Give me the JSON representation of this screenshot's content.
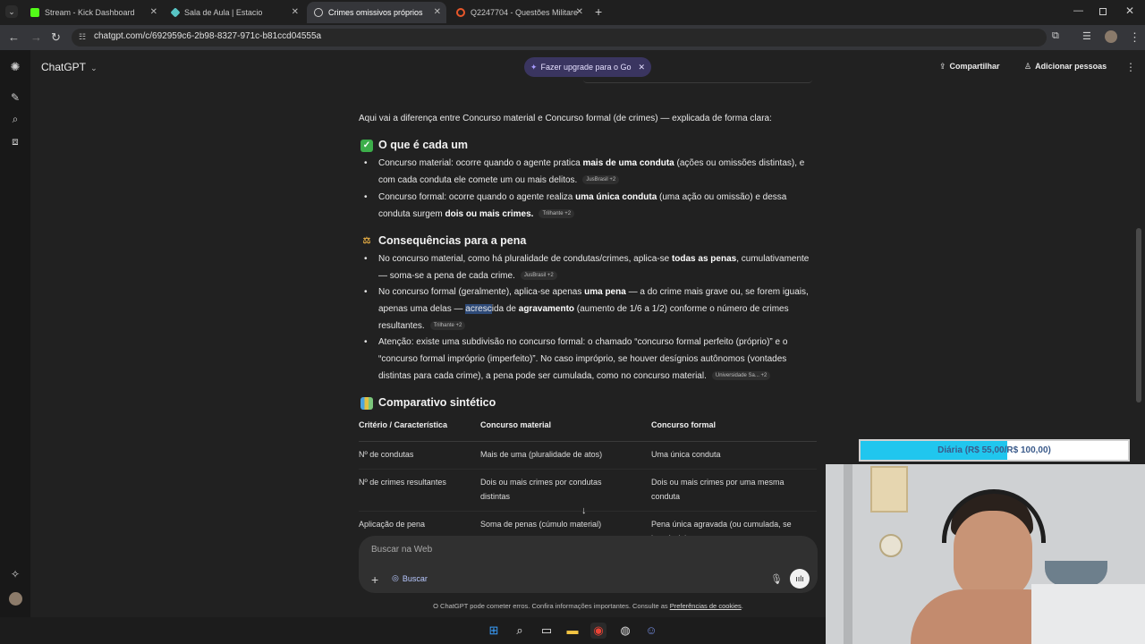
{
  "browser": {
    "tabs": [
      {
        "title": "Stream - Kick Dashboard",
        "color": "#53fc18"
      },
      {
        "title": "Sala de Aula | Estacio",
        "color": "#58c4c4"
      },
      {
        "title": "Crimes omissivos próprios",
        "color": "#cfcfcf"
      },
      {
        "title": "Q2247704 - Questões Militares",
        "color": "#e8572a"
      }
    ],
    "url": "chatgpt.com/c/692959c6-2b98-8327-971c-b81ccd04555a"
  },
  "app": {
    "title": "ChatGPT",
    "upgrade_label": "Fazer upgrade para o Go",
    "share_label": "Compartilhar",
    "add_people_label": "Adicionar pessoas"
  },
  "content": {
    "intro": "Aqui vai a diferença entre Concurso material e Concurso formal (de crimes) — explicada de forma clara:",
    "section1_title": "O que é cada um",
    "s1_b1_a": "Concurso material: ocorre quando o agente pratica ",
    "s1_b1_bold": "mais de uma conduta",
    "s1_b1_c": " (ações ou omissões distintas), e com cada conduta ele comete um ou mais delitos.",
    "s1_b1_src": "JusBrasil +2",
    "s1_b2_a": "Concurso formal: ocorre quando o agente realiza ",
    "s1_b2_bold": "uma única conduta",
    "s1_b2_c": " (uma ação ou omissão) e dessa conduta surgem ",
    "s1_b2_bold2": "dois ou mais crimes.",
    "s1_b2_src": "Trilhante +2",
    "section2_title": "Consequências para a pena",
    "s2_b1_a": "No concurso material, como há pluralidade de condutas/crimes, aplica-se ",
    "s2_b1_bold": "todas as penas",
    "s2_b1_c": ", cumulativamente — soma-se a pena de cada crime.",
    "s2_b1_src": "JusBrasil +2",
    "s2_b2_a": "No concurso formal (geralmente), aplica-se apenas ",
    "s2_b2_bold": "uma pena",
    "s2_b2_c": " — a do crime mais grave ou, se forem iguais, apenas uma delas — ",
    "s2_b2_hl": "acresc",
    "s2_b2_d": "ida de ",
    "s2_b2_bold2": "agravamento",
    "s2_b2_e": " (aumento de 1/6 a 1/2) conforme o número de crimes resultantes.",
    "s2_b2_src": "Trilhante +2",
    "s2_b3": "Atenção: existe uma subdivisão no concurso formal: o chamado “concurso formal perfeito (próprio)” e o “concurso formal impróprio (imperfeito)”. No caso impróprio, se houver desígnios autônomos (vontades distintas para cada crime), a pena pode ser cumulada, como no concurso material.",
    "s2_b3_src": "Universidade Sa... +2",
    "section3_title": "Comparativo sintético",
    "table": {
      "headers": [
        "Critério / Característica",
        "Concurso material",
        "Concurso formal"
      ],
      "rows": [
        [
          "Nº de condutas",
          "Mais de uma (pluralidade de atos)",
          "Uma única conduta"
        ],
        [
          "Nº de crimes resultantes",
          "Dois ou mais crimes por condutas distintas",
          "Dois ou mais crimes por uma mesma conduta"
        ],
        [
          "Aplicação de pena",
          "Soma de penas (cúmulo material)",
          "Pena única agravada (ou cumulada, se impróprio)"
        ]
      ]
    }
  },
  "composer": {
    "placeholder": "Buscar na Web",
    "search_label": "Buscar"
  },
  "disclaimer": {
    "text": "O ChatGPT pode cometer erros. Confira informações importantes. Consulte as ",
    "link": "Preferências de cookies",
    "end": "."
  },
  "overlay": {
    "goal_text": "Diária (R$ 55,00/R$ 100,00)",
    "progress": 0.55
  },
  "colors": {
    "background": "#212121",
    "accent": "#20c6ee",
    "upgrade": "#3a3560"
  }
}
